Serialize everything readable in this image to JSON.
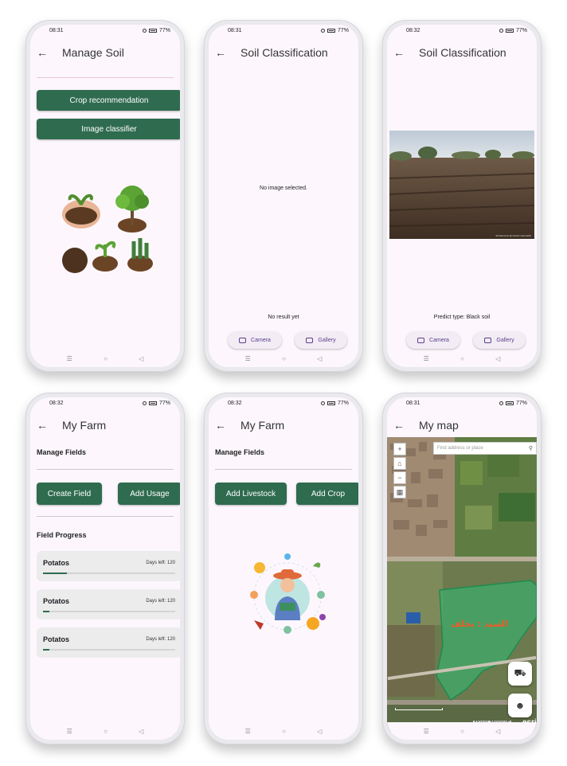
{
  "nav_icons": [
    "menu-icon",
    "home-circle-icon",
    "back-triangle-icon"
  ],
  "phones": {
    "p1": {
      "time": "08:31",
      "battery": "77%",
      "title": "Manage Soil",
      "buttons": [
        "Crop recommendation",
        "Image classifier"
      ]
    },
    "p2": {
      "time": "08:31",
      "battery": "77%",
      "title": "Soil Classification",
      "status": "No image selected.",
      "result": "No result yet",
      "camera": "Camera",
      "gallery": "Gallery"
    },
    "p3": {
      "time": "08:32",
      "battery": "77%",
      "title": "Soil Classification",
      "result": "Predict type: Black soil",
      "camera": "Camera",
      "gallery": "Gallery",
      "watermark": "Shutterstock @mohammadmahdi"
    },
    "p4": {
      "time": "08:32",
      "battery": "77%",
      "title": "My Farm",
      "manage_fields": "Manage Fields",
      "create_field": "Create Field",
      "add_usage": "Add Usage",
      "field_progress": "Field Progress",
      "fields": [
        {
          "name": "Potatos",
          "days": "Days left: 120",
          "progress": 0.18
        },
        {
          "name": "Potatos",
          "days": "Days left: 120",
          "progress": 0.05
        },
        {
          "name": "Potatos",
          "days": "Days left: 120",
          "progress": 0.05
        }
      ]
    },
    "p5": {
      "time": "08:32",
      "battery": "77%",
      "title": "My Farm",
      "manage_fields": "Manage Fields",
      "add_livestock": "Add Livestock",
      "add_crop": "Add Crop"
    },
    "p6": {
      "time": "08:31",
      "battery": "77%",
      "title": "My map",
      "search_placeholder": "Find address or place",
      "field_label": "السيد : يخلف",
      "attribution": "Maxar, Microsoft",
      "esri": "esri"
    }
  },
  "colors": {
    "primary_green": "#2f6b4f",
    "accent_purple": "#5b3f8f",
    "field_overlay": "#37b46e"
  }
}
